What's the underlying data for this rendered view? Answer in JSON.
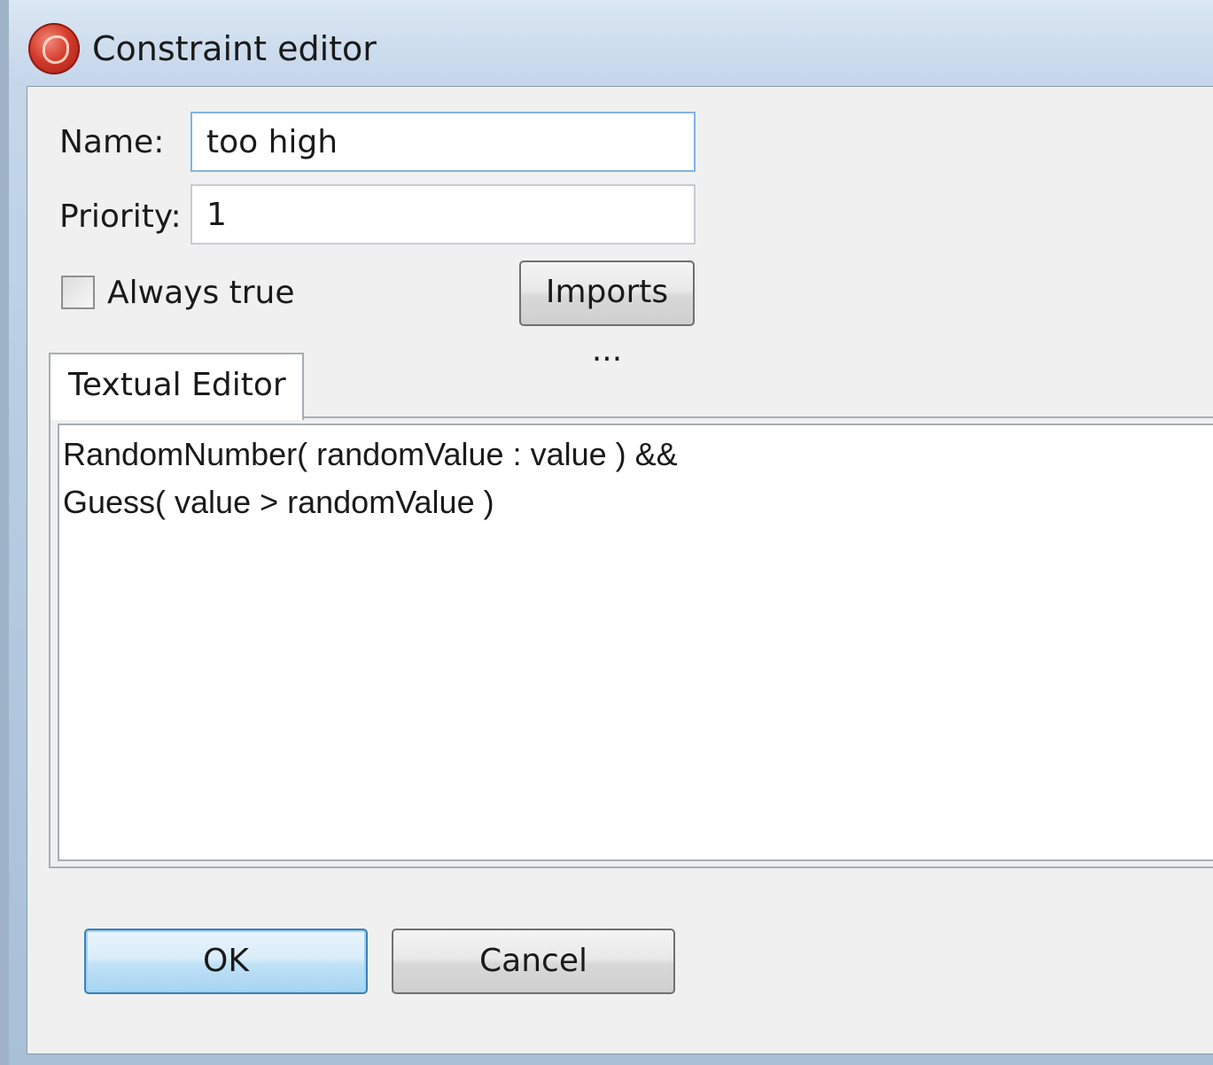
{
  "window": {
    "title": "Constraint editor",
    "icon": "app-logo-icon"
  },
  "form": {
    "name_label": "Name:",
    "name_value": "too high",
    "priority_label": "Priority:",
    "priority_value": "1",
    "always_true_label": "Always true",
    "always_true_checked": false,
    "imports_button": "Imports ..."
  },
  "tabs": [
    {
      "label": "Textual Editor",
      "selected": true
    }
  ],
  "editor": {
    "lines": [
      "RandomNumber( randomValue : value ) &&",
      "Guess( value > randomValue )"
    ]
  },
  "buttons": {
    "ok": "OK",
    "cancel": "Cancel"
  }
}
